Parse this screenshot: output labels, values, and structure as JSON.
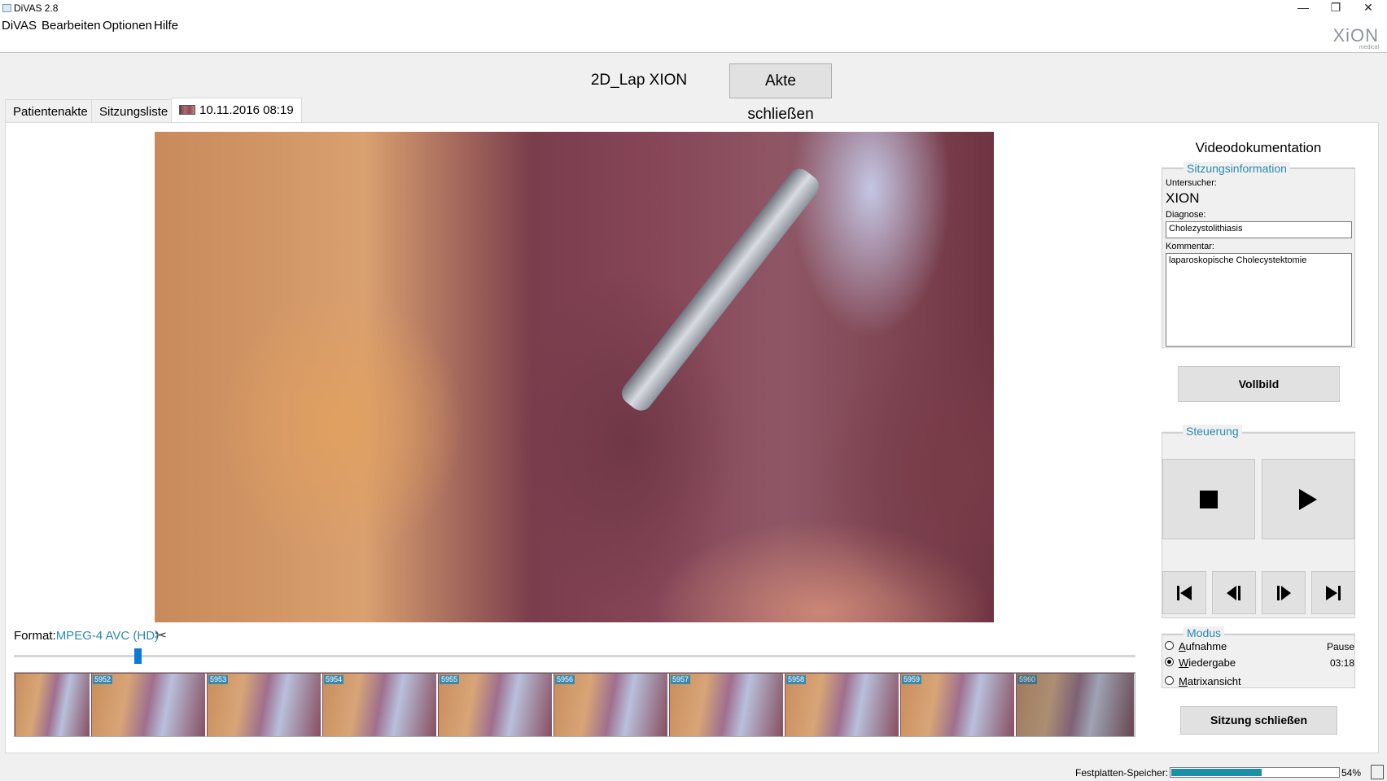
{
  "window": {
    "title": "DiVAS 2.8",
    "minimize": "—",
    "restore": "❐",
    "close": "✕"
  },
  "menu": {
    "items": [
      "DiVAS",
      "Bearbeiten",
      "Optionen",
      "Hilfe"
    ]
  },
  "logo": {
    "brand": "XiON",
    "sub": "medical"
  },
  "header": {
    "session_title": "2D_Lap XION",
    "close_file_button": "Akte schließen"
  },
  "tabs": [
    {
      "label": "Patientenakte"
    },
    {
      "label": "Sitzungsliste"
    },
    {
      "label": "10.11.2016 08:19"
    }
  ],
  "video": {
    "format_label": "Format:",
    "format_value": "MPEG-4 AVC (HD)",
    "position_fraction": 0.11
  },
  "filmstrip": {
    "frames": [
      "",
      "5952",
      "5953",
      "5954",
      "5955",
      "5956",
      "5957",
      "5958",
      "5959",
      "5960"
    ]
  },
  "right_panel": {
    "title": "Videodokumentation",
    "session_info": {
      "legend": "Sitzungsinformation",
      "examiner_label": "Untersucher:",
      "examiner_value": "XION",
      "diagnosis_label": "Diagnose:",
      "diagnosis_value": "Cholezystolithiasis",
      "comment_label": "Kommentar:",
      "comment_value": "laparoskopische Cholecystektomie"
    },
    "fullscreen_button": "Vollbild",
    "control": {
      "legend": "Steuerung"
    },
    "mode": {
      "legend": "Modus",
      "options": [
        {
          "label": "Aufnahme",
          "accel": "A",
          "rest": "ufnahme",
          "value": "Pause",
          "checked": false
        },
        {
          "label": "Wiedergabe",
          "accel": "W",
          "rest": "iedergabe",
          "value": "03:18",
          "checked": true
        },
        {
          "label": "Matrixansicht",
          "accel": "M",
          "rest": "atrixansicht",
          "value": "",
          "checked": false
        }
      ]
    },
    "close_session_button": "Sitzung schließen"
  },
  "status": {
    "storage_label": "Festplatten-Speicher:",
    "storage_percent": "54%",
    "storage_fraction": 0.54
  },
  "colors": {
    "accent": "#2a8ab0",
    "storage_fill": "#1b8fa8",
    "slider_thumb": "#0a7ad4"
  }
}
